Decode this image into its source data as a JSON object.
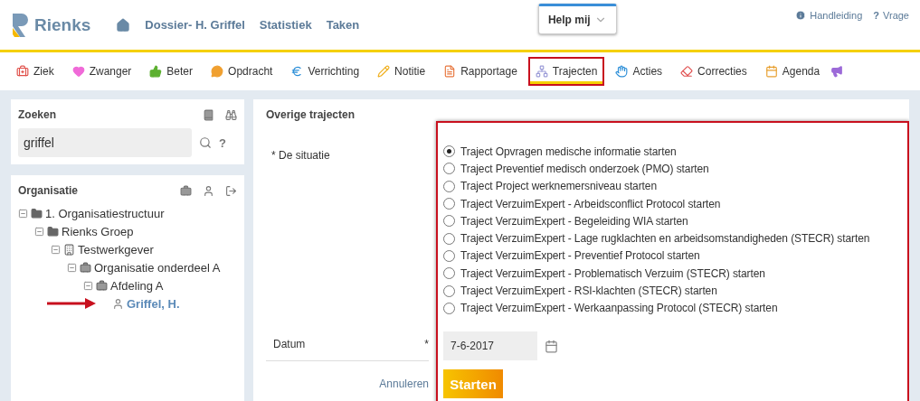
{
  "header": {
    "logo": "Rienks",
    "nav": [
      {
        "label": "Dossier- H. Griffel"
      },
      {
        "label": "Statistiek"
      },
      {
        "label": "Taken"
      }
    ],
    "help": "Help mij",
    "links": [
      {
        "label": "Handleiding",
        "kind": "info"
      },
      {
        "label": "Vrage",
        "kind": "question",
        "icon": "?"
      }
    ]
  },
  "toolbar": [
    {
      "label": "Ziek",
      "selected": false
    },
    {
      "label": "Zwanger",
      "selected": false
    },
    {
      "label": "Beter",
      "selected": false
    },
    {
      "label": "Opdracht",
      "selected": false
    },
    {
      "label": "Verrichting",
      "selected": false
    },
    {
      "label": "Notitie",
      "selected": false
    },
    {
      "label": "Rapportage",
      "selected": false
    },
    {
      "label": "Trajecten",
      "selected": true
    },
    {
      "label": "Acties",
      "selected": false
    },
    {
      "label": "Correcties",
      "selected": false
    },
    {
      "label": "Agenda",
      "selected": false
    }
  ],
  "search": {
    "title": "Zoeken",
    "value": "griffel",
    "help": "?"
  },
  "organisation": {
    "title": "Organisatie",
    "tree": [
      {
        "label": "1. Organisatiestructuur",
        "kind": "folder",
        "selected": false,
        "children": [
          {
            "label": "Rienks Groep",
            "kind": "folder",
            "selected": false,
            "children": [
              {
                "label": "Testwerkgever",
                "kind": "building",
                "selected": false,
                "children": [
                  {
                    "label": "Organisatie onderdeel A",
                    "kind": "briefcase",
                    "selected": false,
                    "children": [
                      {
                        "label": "Afdeling A",
                        "kind": "briefcase",
                        "selected": false,
                        "children": [
                          {
                            "label": "Griffel, H.",
                            "kind": "person",
                            "selected": true
                          }
                        ]
                      }
                    ]
                  }
                ]
              }
            ]
          }
        ]
      }
    ]
  },
  "form": {
    "title": "Overige trajecten",
    "situation_label": "* De situatie",
    "options": [
      {
        "label": "Traject Opvragen medische informatie starten",
        "selected": true
      },
      {
        "label": "Traject Preventief medisch onderzoek (PMO) starten",
        "selected": false
      },
      {
        "label": "Traject Project werknemersniveau starten",
        "selected": false
      },
      {
        "label": "Traject VerzuimExpert - Arbeidsconflict Protocol starten",
        "selected": false
      },
      {
        "label": "Traject VerzuimExpert - Begeleiding WIA starten",
        "selected": false
      },
      {
        "label": "Traject VerzuimExpert - Lage rugklachten en arbeidsomstandigheden (STECR) starten",
        "selected": false
      },
      {
        "label": "Traject VerzuimExpert - Preventief Protocol starten",
        "selected": false
      },
      {
        "label": "Traject VerzuimExpert - Problematisch Verzuim (STECR) starten",
        "selected": false
      },
      {
        "label": "Traject VerzuimExpert - RSI-klachten (STECR) starten",
        "selected": false
      },
      {
        "label": "Traject VerzuimExpert - Werkaanpassing Protocol (STECR) starten",
        "selected": false
      }
    ],
    "date_label": "Datum",
    "date_required": "*",
    "date": "7-6-2017",
    "cancel": "Annuleren",
    "submit": "Starten"
  }
}
